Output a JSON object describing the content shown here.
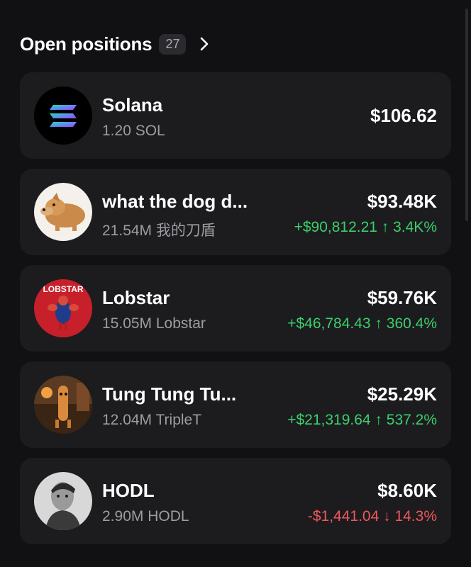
{
  "header": {
    "title": "Open positions",
    "count": "27",
    "chevron_icon": "chevron-right-icon"
  },
  "positions": [
    {
      "name": "Solana",
      "amount": "1.20 SOL",
      "value": "$106.62",
      "change": "",
      "trend": "none",
      "icon": "solana-logo"
    },
    {
      "name": "what the dog d...",
      "amount": "21.54M 我的刀盾",
      "value": "$93.48K",
      "change": "+$90,812.21 ↑ 3.4K%",
      "trend": "up",
      "icon": "dog-token-avatar"
    },
    {
      "name": "Lobstar",
      "amount": "15.05M Lobstar",
      "value": "$59.76K",
      "change": "+$46,784.43 ↑ 360.4%",
      "trend": "up",
      "icon": "lobstar-token-avatar",
      "icon_text": "LOBSTAR"
    },
    {
      "name": "Tung Tung Tu...",
      "amount": "12.04M TripleT",
      "value": "$25.29K",
      "change": "+$21,319.64 ↑ 537.2%",
      "trend": "up",
      "icon": "triplet-token-avatar"
    },
    {
      "name": "HODL",
      "amount": "2.90M HODL",
      "value": "$8.60K",
      "change": "-$1,441.04 ↓ 14.3%",
      "trend": "down",
      "icon": "hodl-token-avatar"
    }
  ],
  "colors": {
    "background": "#111113",
    "card": "#1c1c1f",
    "positive": "#3ccf6b",
    "negative": "#f0575b",
    "muted": "#9c9ca2"
  }
}
